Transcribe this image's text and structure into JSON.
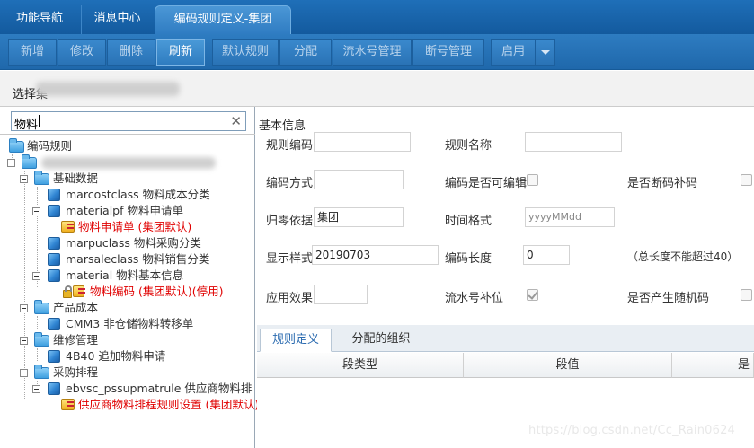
{
  "top_tabs": [
    "功能导航",
    "消息中心",
    "编码规则定义-集团"
  ],
  "toolbar": {
    "add": "新增",
    "edit": "修改",
    "delete": "删除",
    "refresh": "刷新",
    "default_rule": "默认规则",
    "assign": "分配",
    "serial_mgmt": "流水号管理",
    "gap_mgmt": "断号管理",
    "enable": "启用"
  },
  "org_select": {
    "label": "选择集"
  },
  "search": {
    "value": "物料"
  },
  "tree": {
    "root": "编码规则",
    "basic_data": "基础数据",
    "marcostclass": "marcostclass  物料成本分类",
    "materialpf": "materialpf  物料申请单",
    "materialpf_rule": "物料申请单 (集团默认)",
    "marpuclass": "marpuclass  物料采购分类",
    "marsaleclass": "marsaleclass  物料销售分类",
    "material": "material  物料基本信息",
    "material_rule": "物料编码 (集团默认)(停用)",
    "product_cost": "产品成本",
    "cmm3": "CMM3  非仓储物料转移单",
    "maintenance": "维修管理",
    "b40": "4B40  追加物料申请",
    "procurement": "采购排程",
    "ebvsc": "ebvsc_pssupmatrule  供应商物料排程",
    "ebvsc_rule": "供应商物料排程规则设置 (集团默认)"
  },
  "form": {
    "section": "基本信息",
    "rule_code": "规则编码",
    "rule_name": "规则名称",
    "code_mode": "编码方式",
    "editable": "编码是否可编辑",
    "fill_gap": "是否断码补码",
    "reset_basis": "归零依据",
    "reset_value": "集团",
    "time_format": "时间格式",
    "time_format_value": "yyyyMMdd",
    "display_style": "显示样式",
    "display_value": "20190703",
    "code_length": "编码长度",
    "code_length_value": "0",
    "length_note": "（总长度不能超过40）",
    "apply_effect": "应用效果",
    "serial_pad": "流水号补位",
    "random_code": "是否产生随机码"
  },
  "lower_tabs": [
    "规则定义",
    "分配的组织"
  ],
  "grid_headers": [
    "段类型",
    "段值",
    "是"
  ],
  "watermark": "https://blog.csdn.net/Cc_Rain0624"
}
